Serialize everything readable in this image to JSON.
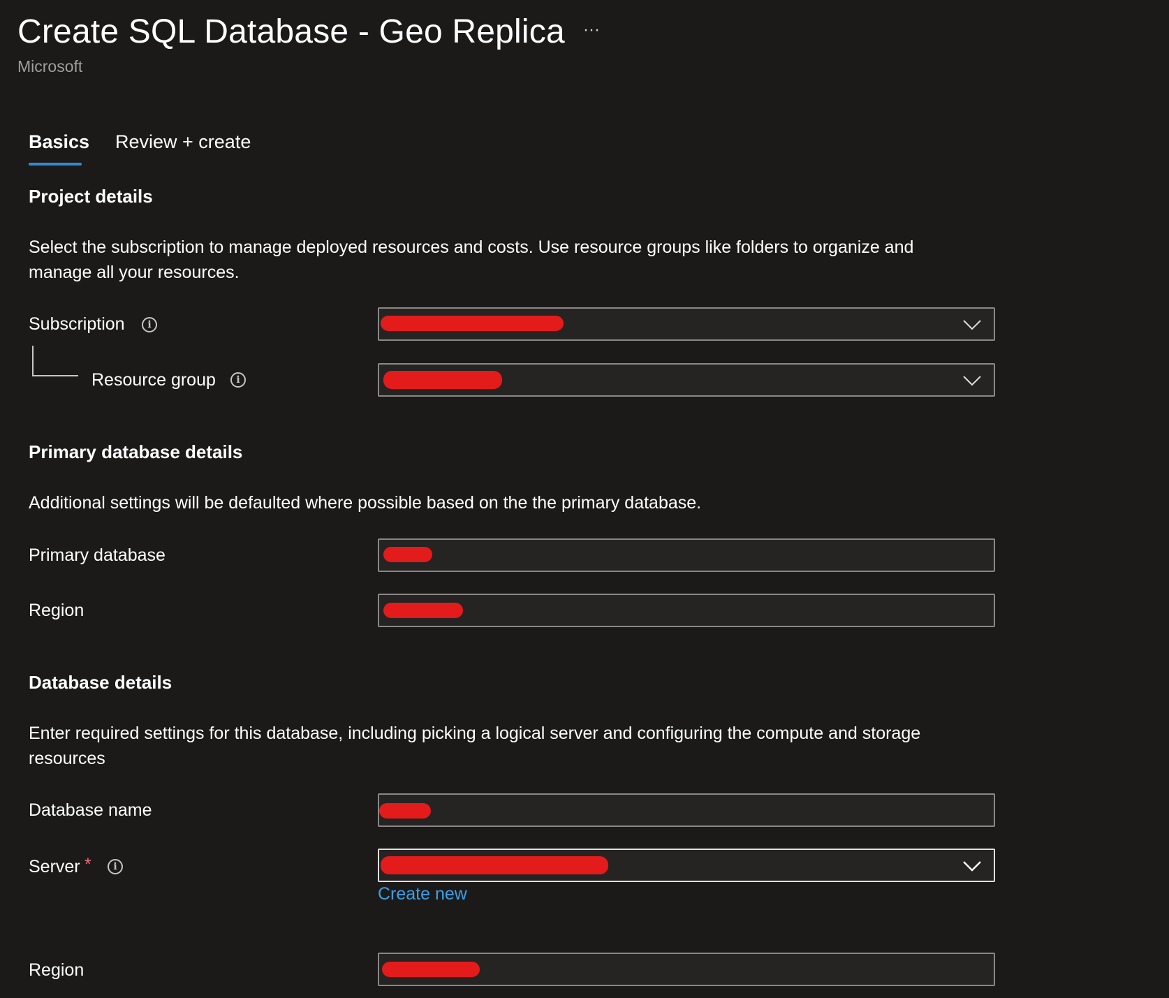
{
  "header": {
    "title": "Create SQL Database - Geo Replica",
    "more_label": "···",
    "publisher": "Microsoft"
  },
  "tabs": [
    {
      "label": "Basics",
      "active": true
    },
    {
      "label": "Review + create",
      "active": false
    }
  ],
  "project_details": {
    "heading": "Project details",
    "description": "Select the subscription to manage deployed resources and costs. Use resource groups like folders to organize and manage all your resources.",
    "subscription": {
      "label": "Subscription",
      "info_icon": "info-icon",
      "value": ""
    },
    "resource_group": {
      "label": "Resource group",
      "info_icon": "info-icon",
      "value": ""
    }
  },
  "primary_database_details": {
    "heading": "Primary database details",
    "description": "Additional settings will be defaulted where possible based on the the primary database.",
    "primary_database": {
      "label": "Primary database",
      "value": ""
    },
    "region": {
      "label": "Region",
      "value": ""
    }
  },
  "database_details": {
    "heading": "Database details",
    "description": "Enter required settings for this database, including picking a logical server and configuring the compute and storage resources",
    "database_name": {
      "label": "Database name",
      "value": ""
    },
    "server": {
      "label": "Server",
      "required_marker": "*",
      "info_icon": "info-icon",
      "value": "",
      "create_new": "Create new"
    },
    "region": {
      "label": "Region",
      "value": ""
    }
  },
  "colors": {
    "background": "#1b1a19",
    "input_background": "#252423",
    "accent": "#2f8bd8",
    "link": "#3b9fe8",
    "redaction": "#e31b1b",
    "required": "#f1707b"
  }
}
